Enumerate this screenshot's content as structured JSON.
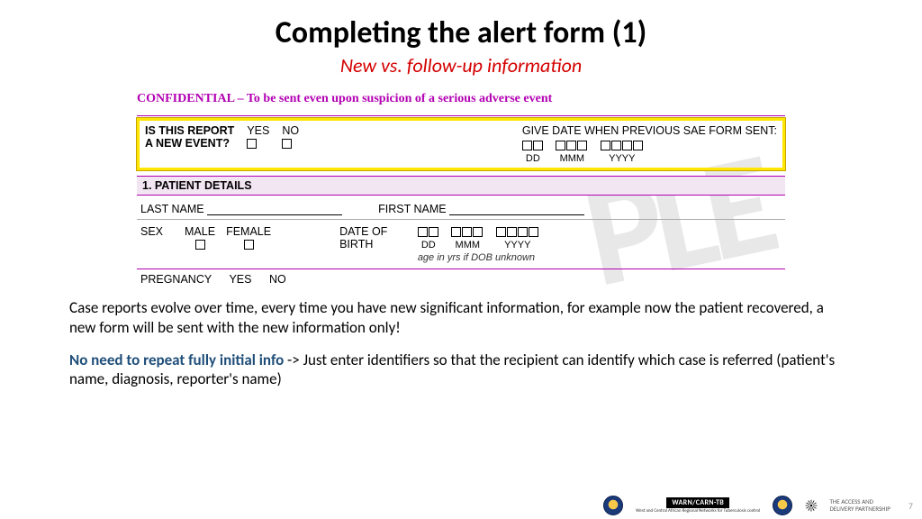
{
  "title": "Completing the alert form (1)",
  "subtitle": "New vs. follow-up information",
  "form": {
    "confidential": "CONFIDENTIAL – To be sent even upon suspicion of a serious adverse event",
    "newEvent": {
      "label1": "IS THIS REPORT",
      "label2": "A NEW EVENT?",
      "yes": "YES",
      "no": "NO",
      "dateLabel": "GIVE DATE WHEN PREVIOUS SAE FORM SENT:",
      "dd": "DD",
      "mmm": "MMM",
      "yyyy": "YYYY"
    },
    "section1": "1. PATIENT DETAILS",
    "lastName": "LAST NAME",
    "firstName": "FIRST NAME",
    "sex": "SEX",
    "male": "MALE",
    "female": "FEMALE",
    "dobLabel1": "DATE OF",
    "dobLabel2": "BIRTH",
    "ageHint": "age in yrs if DOB unknown",
    "pregnancy": "PREGNANCY",
    "pyes": "YES",
    "pno": "NO"
  },
  "body": {
    "p1": "Case reports evolve over time, every time you have new significant information, for example now the patient recovered, a new form will be sent with the new information only!",
    "lead2": "No need to repeat fully initial info",
    "p2": " ->  Just enter identifiers so that the recipient can identify which case is referred (patient's name, diagnosis, reporter's name)"
  },
  "footer": {
    "warn": "WARN/CARN-TB",
    "warnSub": "West and Central African Regional Networks for Tuberculosis control",
    "partner1": "THE ACCESS AND",
    "partner2": "DELIVERY PARTNERSHIP",
    "page": "7"
  },
  "watermark": "PLE"
}
